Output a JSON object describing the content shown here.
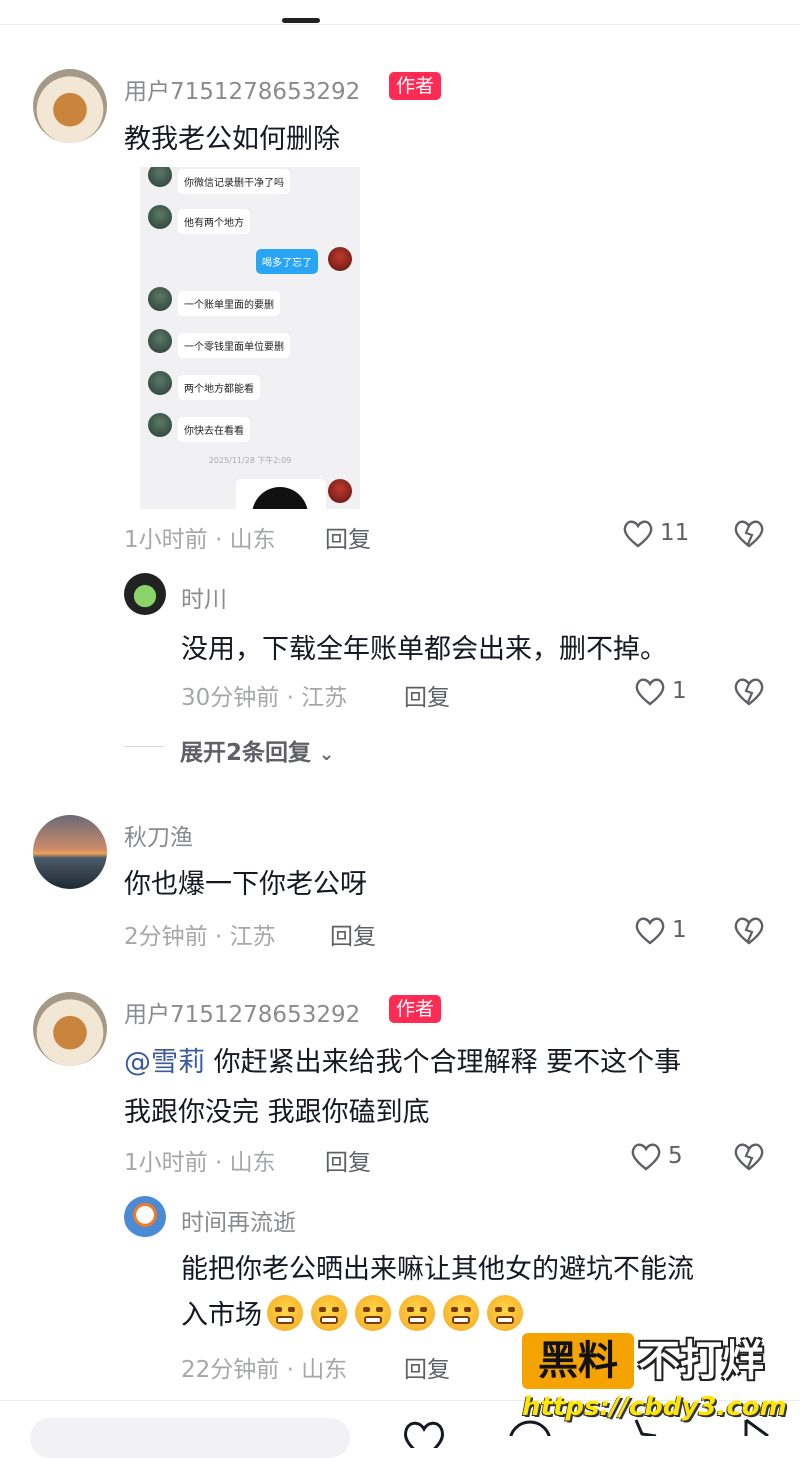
{
  "comments": [
    {
      "username": "用户7151278653292",
      "badge": "作者",
      "text": "教我老公如何删除",
      "time_location": "1小时前 · 山东",
      "reply_label": "回复",
      "likes": "11",
      "screenshot": {
        "messages": [
          "你微信记录删干净了吗",
          "他有两个地方",
          "喝多了忘了",
          "一个账单里面的要删",
          "一个零钱里面单位要删",
          "两个地方都能看",
          "你快去在看看"
        ],
        "timestamp": "2025/11/28 下午2:09"
      },
      "replies": [
        {
          "username": "时川",
          "text": "没用，下载全年账单都会出来，删不掉。",
          "time_location": "30分钟前 · 江苏",
          "reply_label": "回复",
          "likes": "1"
        }
      ],
      "expand_label": "展开2条回复"
    },
    {
      "username": "秋刀渔",
      "text": "你也爆一下你老公呀",
      "time_location": "2分钟前 · 江苏",
      "reply_label": "回复",
      "likes": "1"
    },
    {
      "username": "用户7151278653292",
      "badge": "作者",
      "mention": "@雪莉",
      "text_line1": " 你赶紧出来给我个合理解释 要不这个事",
      "text_line2": "我跟你没完 我跟你磕到底",
      "time_location": "1小时前 · 山东",
      "reply_label": "回复",
      "likes": "5",
      "replies": [
        {
          "username": "时间再流逝",
          "text_line1": "能把你老公晒出来嘛让其他女的避坑不能流",
          "text_line2": "入市场",
          "emoji_name": "grinning-face-emoji",
          "time_location": "22分钟前 · 山东",
          "reply_label": "回复"
        }
      ]
    }
  ],
  "watermark": {
    "badge": "黑料",
    "text": "不打烊",
    "url": "https://cbdy3.com"
  },
  "colors": {
    "badge": "#fe2c55",
    "mention": "#3a5a9c",
    "watermark_orange": "#f5a300",
    "watermark_yellow": "#ffe600"
  }
}
